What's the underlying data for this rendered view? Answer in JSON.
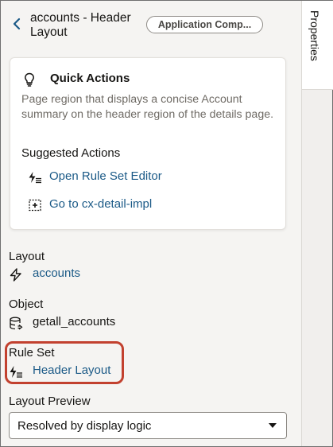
{
  "header": {
    "title": "accounts - Header Layout",
    "badge": "Application Comp..."
  },
  "quick_actions": {
    "title": "Quick Actions",
    "description": "Page region that displays a concise Account summary on the header region of the details page.",
    "suggested_title": "Suggested Actions",
    "actions": [
      {
        "label": "Open Rule Set Editor",
        "icon": "rule-set-icon"
      },
      {
        "label": "Go to cx-detail-impl",
        "icon": "page-target-icon"
      }
    ]
  },
  "properties": {
    "layout": {
      "label": "Layout",
      "value": "accounts",
      "icon": "lightning-icon"
    },
    "object": {
      "label": "Object",
      "value": "getall_accounts",
      "icon": "database-icon"
    },
    "rule_set": {
      "label": "Rule Set",
      "value": "Header Layout",
      "icon": "rule-set-icon"
    },
    "layout_preview": {
      "label": "Layout Preview",
      "selected": "Resolved by display logic"
    }
  },
  "side_rail": {
    "tab_label": "Properties"
  },
  "colors": {
    "link": "#1b5a87",
    "highlight": "#c2412f",
    "panel_bg": "#f5f4f2"
  }
}
